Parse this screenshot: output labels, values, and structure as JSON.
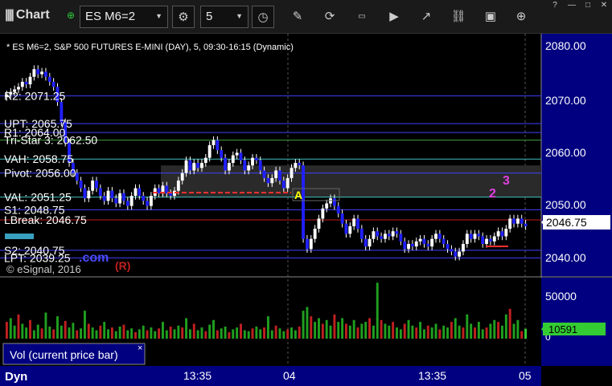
{
  "toolbar": {
    "app_title": "Chart",
    "symbol": "ES M6=2",
    "interval": "5"
  },
  "chart_header": {
    "info": "* ES M6=2, S&P 500 FUTURES E-MINI (DAY), 5, 09:30-16:15 (Dynamic)",
    "copyright": "© eSignal, 2016",
    "watermark": ".com"
  },
  "price_axis": {
    "ticks": [
      "2080.00",
      "2070.00",
      "2060.00",
      "2050.00",
      "2040.00"
    ],
    "last_price": "2046.75"
  },
  "volume_axis": {
    "ticks": [
      "50000",
      "0"
    ],
    "last_volume": "10591"
  },
  "volume_panel": {
    "label": "Vol (current price bar)",
    "close_icon": "×"
  },
  "time_axis": {
    "ticks": [
      "13:35",
      "04",
      "13:35",
      "05"
    ]
  },
  "footer": {
    "label": "Dyn"
  },
  "annotations": {
    "marker_a": "A",
    "marker_r": "(R)",
    "marker_2": "2",
    "marker_3": "3"
  },
  "levels": [
    {
      "label": "R2: 2071.25",
      "value": 2071.25,
      "color": "#4040ff"
    },
    {
      "label": "UPT: 2065.75",
      "value": 2065.75,
      "color": "#4040ff"
    },
    {
      "label": "R1: 2064.00",
      "value": 2064.0,
      "color": "#4040ff"
    },
    {
      "label": "Tri-Star 3: 2062.50",
      "value": 2062.5,
      "color": "#40a040"
    },
    {
      "label": "VAH: 2058.75",
      "value": 2058.75,
      "color": "#40c0c0"
    },
    {
      "label": "Pivot: 2056.00",
      "value": 2056.0,
      "color": "#4040ff"
    },
    {
      "label": "VAL: 2051.25",
      "value": 2051.25,
      "color": "#40c0c0"
    },
    {
      "label": "S1: 2048.75",
      "value": 2048.75,
      "color": "#4040ff"
    },
    {
      "label": "LBreak: 2046.75",
      "value": 2046.75,
      "color": "#c02020"
    },
    {
      "label": "S2: 2040.75",
      "value": 2040.75,
      "color": "#4040ff"
    },
    {
      "label": "LPT: 2039.25",
      "value": 2039.25,
      "color": "#4040ff"
    }
  ],
  "chart_data": {
    "type": "candlestick",
    "ylim": [
      2035.5,
      2083.5
    ],
    "closes": [
      2071.5,
      2072.0,
      2072.5,
      2073.0,
      2074.0,
      2073.5,
      2075.0,
      2076.5,
      2075.5,
      2076.0,
      2075.0,
      2074.0,
      2073.0,
      2070.0,
      2066.0,
      2062.0,
      2058.0,
      2056.0,
      2054.5,
      2053.0,
      2051.0,
      2052.5,
      2054.5,
      2053.0,
      2051.5,
      2050.5,
      2052.5,
      2051.0,
      2050.0,
      2052.0,
      2050.5,
      2049.5,
      2051.5,
      2053.0,
      2051.5,
      2050.5,
      2049.5,
      2051.5,
      2053.0,
      2052.0,
      2053.5,
      2052.0,
      2051.5,
      2052.5,
      2054.5,
      2056.0,
      2058.5,
      2056.5,
      2058.0,
      2057.0,
      2058.0,
      2059.0,
      2061.5,
      2062.5,
      2060.5,
      2059.0,
      2056.5,
      2058.0,
      2059.5,
      2060.0,
      2058.5,
      2056.5,
      2057.5,
      2059.0,
      2058.5,
      2056.5,
      2055.0,
      2054.0,
      2055.0,
      2056.5,
      2054.5,
      2053.0,
      2055.0,
      2057.0,
      2058.0,
      2057.5,
      2043.0,
      2041.0,
      2043.0,
      2045.0,
      2047.0,
      2049.0,
      2050.0,
      2051.0,
      2049.5,
      2048.0,
      2046.0,
      2044.0,
      2045.5,
      2047.0,
      2045.0,
      2043.0,
      2041.5,
      2043.0,
      2044.5,
      2043.5,
      2043.0,
      2044.0,
      2043.5,
      2044.5,
      2044.0,
      2042.5,
      2041.0,
      2042.0,
      2041.5,
      2042.5,
      2043.0,
      2042.0,
      2041.5,
      2043.0,
      2044.0,
      2043.0,
      2042.0,
      2041.0,
      2040.5,
      2039.5,
      2040.5,
      2042.0,
      2044.0,
      2043.0,
      2044.0,
      2043.5,
      2042.0,
      2043.0,
      2042.5,
      2043.5,
      2044.5,
      2043.5,
      2045.0,
      2047.0,
      2046.0,
      2047.0,
      2046.0,
      2045.5
    ]
  },
  "volumes": [
    18000,
    22000,
    14000,
    26000,
    16000,
    12000,
    20000,
    9000,
    15000,
    11000,
    28000,
    13000,
    10000,
    24000,
    14000,
    19000,
    12000,
    17000,
    9000,
    11000,
    30000,
    16000,
    12000,
    9000,
    14000,
    18000,
    10000,
    12000,
    8000,
    13000,
    15000,
    9000,
    11000,
    7000,
    10000,
    14000,
    9000,
    12000,
    8000,
    11000,
    18000,
    9000,
    13000,
    10000,
    14000,
    12000,
    22000,
    10000,
    16000,
    9000,
    12000,
    8000,
    15000,
    20000,
    9000,
    11000,
    13000,
    7000,
    10000,
    12000,
    16000,
    9000,
    8000,
    11000,
    13000,
    10000,
    12000,
    24000,
    9000,
    14000,
    11000,
    8000,
    10000,
    12000,
    9000,
    13000,
    30000,
    34000,
    24000,
    18000,
    22000,
    16000,
    20000,
    14000,
    26000,
    18000,
    22000,
    16000,
    14000,
    20000,
    12000,
    16000,
    18000,
    22000,
    14000,
    60000,
    20000,
    16000,
    14000,
    18000,
    12000,
    10000,
    16000,
    20000,
    14000,
    12000,
    18000,
    10000,
    14000,
    12000,
    16000,
    10000,
    14000,
    12000,
    18000,
    22000,
    14000,
    12000,
    26000,
    16000,
    12000,
    18000,
    10000,
    12000,
    16000,
    20000,
    18000,
    14000,
    26000,
    32000,
    16000,
    20000,
    8000,
    10591
  ]
}
